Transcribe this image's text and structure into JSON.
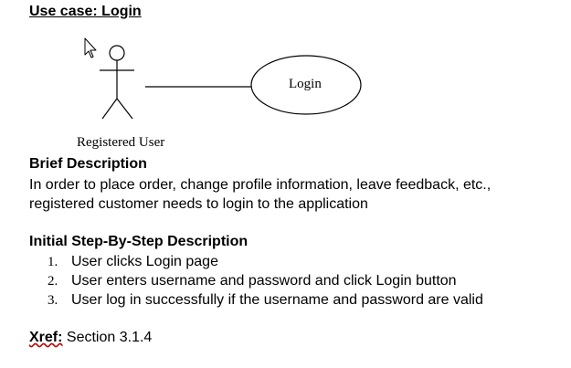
{
  "document": {
    "title": "Use case: Login",
    "diagram": {
      "actor_name": "Registered User",
      "usecase_name": "Login"
    },
    "brief_description": {
      "heading": "Brief Description",
      "text": "In order to place order, change profile information, leave feedback, etc., registered customer needs to login to the application"
    },
    "steps_section": {
      "heading": "Initial Step-By-Step Description",
      "items": [
        {
          "num": "1.",
          "text": "User clicks Login page"
        },
        {
          "num": "2.",
          "text": "User enters username and password and click Login button"
        },
        {
          "num": "3.",
          "text": "User log in successfully if the username and password are valid"
        }
      ]
    },
    "xref": {
      "label": "Xref:",
      "value": "Section 3.1.4"
    }
  }
}
